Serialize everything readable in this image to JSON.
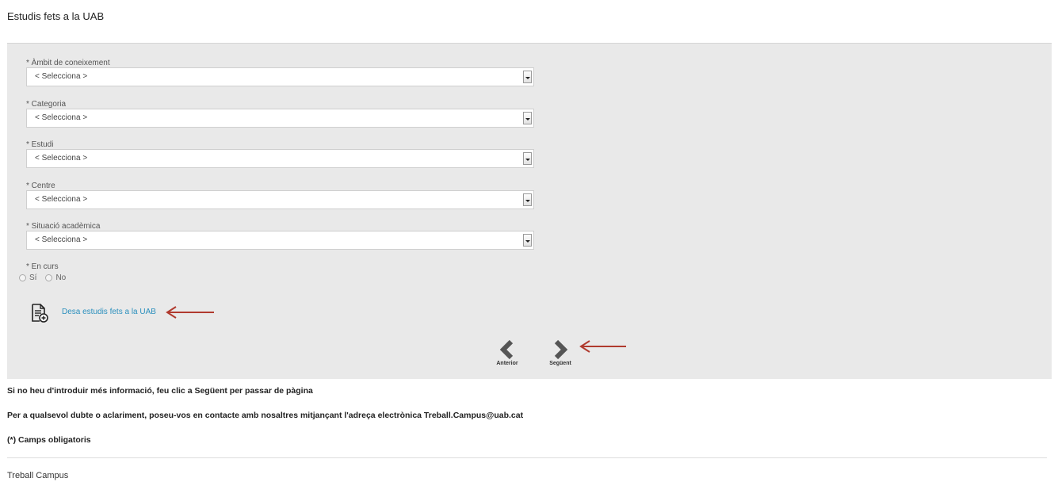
{
  "page": {
    "title": "Estudis fets a la UAB"
  },
  "form": {
    "fields": [
      {
        "label": "* Àmbit de coneixement",
        "value": "< Selecciona >"
      },
      {
        "label": "* Categoria",
        "value": "< Selecciona >"
      },
      {
        "label": "* Estudi",
        "value": "< Selecciona >"
      },
      {
        "label": "* Centre",
        "value": "< Selecciona >"
      },
      {
        "label": "* Situació acadèmica",
        "value": "< Selecciona >"
      }
    ],
    "en_curs": {
      "label": "* En curs",
      "option_yes": "Sí",
      "option_no": "No"
    },
    "save_link": "Desa estudis fets a la UAB"
  },
  "nav": {
    "prev_label": "Anterior",
    "next_label": "Següent"
  },
  "info": {
    "line1": "Si no heu d'introduir més informació, feu clic a Següent per passar de pàgina",
    "line2": "Per a qualsevol dubte o aclariment, poseu-vos en contacte amb nosaltres mitjançant l'adreça electrònica Treball.Campus@uab.cat",
    "required_note": "(*) Camps obligatoris"
  },
  "footer": {
    "text": "Treball Campus"
  },
  "icons": {
    "save": "document-add-icon",
    "annotation_arrow": "red-left-arrow-icon",
    "prev": "chevron-left-icon",
    "next": "chevron-right-icon"
  },
  "colors": {
    "panel_bg": "#e9e9e9",
    "link": "#2a8fbd",
    "annotation": "#b03a2e"
  }
}
